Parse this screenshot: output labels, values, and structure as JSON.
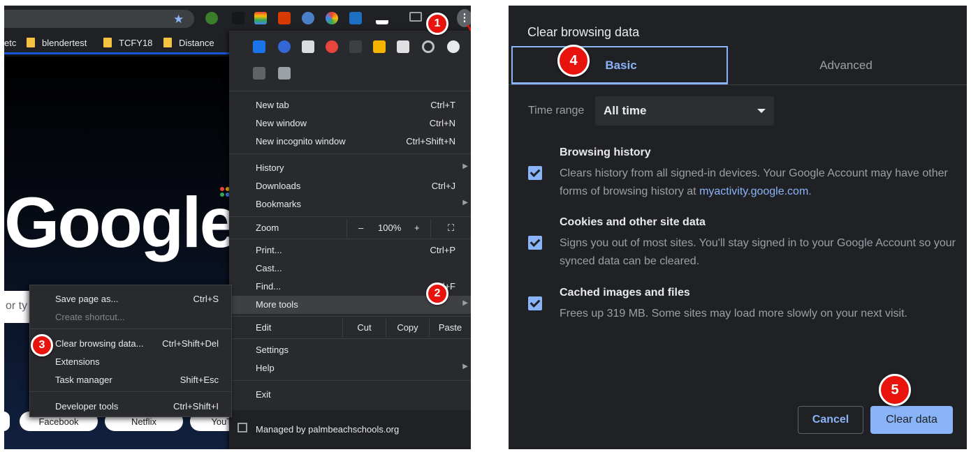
{
  "left": {
    "bookmarks": [
      {
        "label": "etc"
      },
      {
        "label": "blendertest"
      },
      {
        "label": "TCFY18"
      },
      {
        "label": "Distance"
      }
    ],
    "google_logo": "Google",
    "search_placeholder": "or ty",
    "shortcuts": [
      "Facebook",
      "Netflix",
      "YouTube"
    ],
    "main_menu": {
      "new_tab": {
        "label": "New tab",
        "shortcut": "Ctrl+T"
      },
      "new_window": {
        "label": "New window",
        "shortcut": "Ctrl+N"
      },
      "new_incognito": {
        "label": "New incognito window",
        "shortcut": "Ctrl+Shift+N"
      },
      "history": {
        "label": "History"
      },
      "downloads": {
        "label": "Downloads",
        "shortcut": "Ctrl+J"
      },
      "bookmarks": {
        "label": "Bookmarks"
      },
      "zoom": {
        "label": "Zoom",
        "minus": "–",
        "value": "100%",
        "plus": "+"
      },
      "print": {
        "label": "Print...",
        "shortcut": "Ctrl+P"
      },
      "cast": {
        "label": "Cast..."
      },
      "find": {
        "label": "Find...",
        "shortcut": "Ctrl+F"
      },
      "more_tools": {
        "label": "More tools"
      },
      "edit": {
        "label": "Edit",
        "cut": "Cut",
        "copy": "Copy",
        "paste": "Paste"
      },
      "settings": {
        "label": "Settings"
      },
      "help": {
        "label": "Help"
      },
      "exit": {
        "label": "Exit"
      },
      "managed": "Managed by palmbeachschools.org"
    },
    "sub_menu": {
      "save_page": {
        "label": "Save page as...",
        "shortcut": "Ctrl+S"
      },
      "create_shortcut": {
        "label": "Create shortcut..."
      },
      "clear_data": {
        "label": "Clear browsing data...",
        "shortcut": "Ctrl+Shift+Del"
      },
      "extensions": {
        "label": "Extensions"
      },
      "task_manager": {
        "label": "Task manager",
        "shortcut": "Shift+Esc"
      },
      "dev_tools": {
        "label": "Developer tools",
        "shortcut": "Ctrl+Shift+I"
      }
    }
  },
  "badges": [
    "1",
    "2",
    "3",
    "4",
    "5"
  ],
  "dialog": {
    "title": "Clear browsing data",
    "tabs": {
      "basic": "Basic",
      "advanced": "Advanced"
    },
    "time_range_label": "Time range",
    "time_range_value": "All time",
    "options": {
      "history": {
        "title": "Browsing history",
        "desc": "Clears history from all signed-in devices. Your Google Account may have other forms of browsing history at ",
        "link": "myactivity.google.com",
        "desc_end": "."
      },
      "cookies": {
        "title": "Cookies and other site data",
        "desc": "Signs you out of most sites. You'll stay signed in to your Google Account so your synced data can be cleared."
      },
      "cache": {
        "title": "Cached images and files",
        "desc": "Frees up 319 MB. Some sites may load more slowly on your next visit."
      }
    },
    "cancel": "Cancel",
    "clear": "Clear data"
  },
  "colors": {
    "accent": "#8ab4f8",
    "badge_red": "#e8130c",
    "menu_bg": "#292a2d",
    "dialog_bg": "#202124"
  }
}
